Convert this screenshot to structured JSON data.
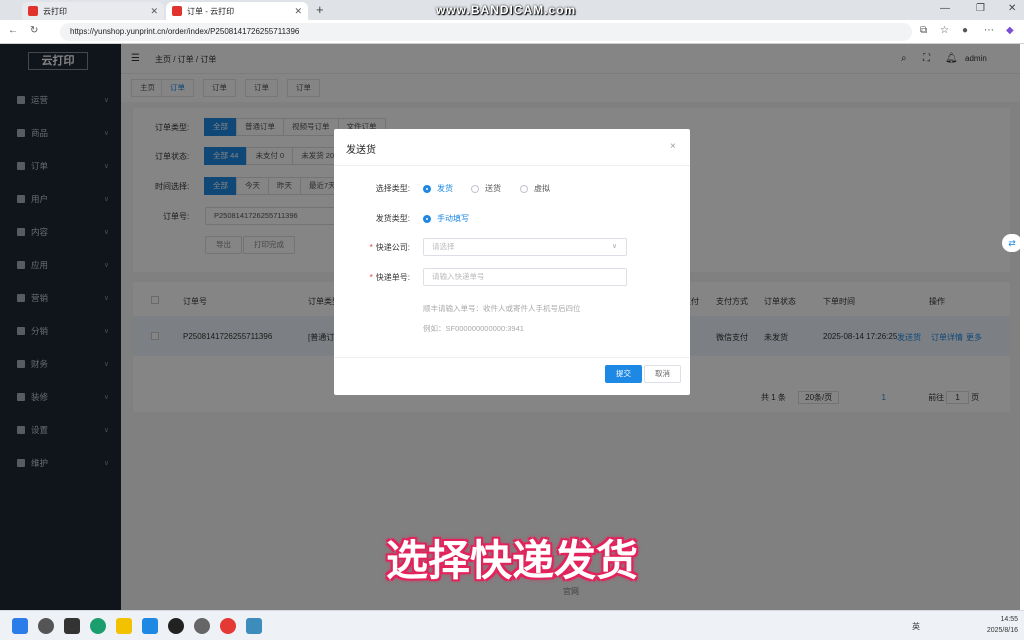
{
  "browser": {
    "tab1": "云打印",
    "tab2": "订单 - 云打印",
    "url": "https://yunshop.yunprint.cn/order/index/P2508141726255711396",
    "watermark": "www.BANDICAM.com"
  },
  "sidebar": {
    "logo_text": "云打印",
    "items": [
      {
        "label": "运营"
      },
      {
        "label": "商品"
      },
      {
        "label": "订单"
      },
      {
        "label": "用户"
      },
      {
        "label": "内容"
      },
      {
        "label": "应用"
      },
      {
        "label": "营销"
      },
      {
        "label": "分销"
      },
      {
        "label": "财务"
      },
      {
        "label": "装修"
      },
      {
        "label": "设置"
      },
      {
        "label": "维护"
      }
    ]
  },
  "header": {
    "breadcrumb": [
      "主页",
      "订单",
      "订单"
    ],
    "user": "admin"
  },
  "tags": [
    "主页",
    "订单",
    "订单",
    "订单",
    "订单"
  ],
  "filters": {
    "type_label": "订单类型:",
    "type_options": [
      "全部",
      "普通订单",
      "视频号订单",
      "文件订单"
    ],
    "status_label": "订单状态:",
    "status_options": [
      "全部 44",
      "未支付 0",
      "未发货 20"
    ],
    "time_label": "时间选择:",
    "time_options": [
      "全部",
      "今天",
      "昨天",
      "最近7天"
    ],
    "order_no_label": "订单号:",
    "order_no_value": "P2508141726255711396",
    "export": "导出",
    "print_done": "打印完成"
  },
  "table": {
    "headers": [
      "订单号",
      "订单类型",
      "支付",
      "支付方式",
      "订单状态",
      "下单时间",
      "操作"
    ],
    "row": {
      "order_no": "P2508141726255711396",
      "type": "[普通订单]",
      "pay_method": "微信支付",
      "status": "未发货",
      "time": "2025-08-14 17:26:25",
      "actions": [
        "发送货",
        "订单详情",
        "更多"
      ]
    }
  },
  "pagination": {
    "total": "共 1 条",
    "page_size": "20条/页",
    "current": "1",
    "goto_label": "前往",
    "goto_value": "1",
    "page_suffix": "页"
  },
  "dialog": {
    "title": "发送货",
    "select_type_label": "选择类型:",
    "select_type_options": [
      "发货",
      "送货",
      "虚拟"
    ],
    "ship_type_label": "发货类型:",
    "ship_type_option": "手动填写",
    "courier_label": "快递公司:",
    "courier_placeholder": "请选择",
    "tracking_label": "快递单号:",
    "tracking_placeholder": "请输入快递单号",
    "hint1": "顺丰请输入单号：收件人或寄件人手机号后四位",
    "hint2": "例如：SF000000000000:3941",
    "submit": "提交",
    "cancel": "取消"
  },
  "footer_text": "官网",
  "caption": "选择快递发货",
  "taskbar": {
    "lang": "英",
    "time": "14:55",
    "date": "2025/8/16"
  }
}
